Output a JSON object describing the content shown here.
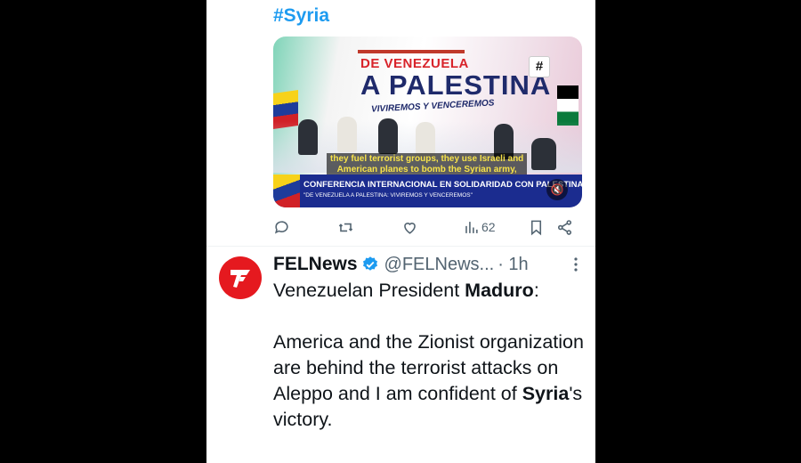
{
  "prev_tweet": {
    "hashtag": "#Syria",
    "media": {
      "title_small": "DE VENEZUELA",
      "title_big": "A PALESTINA",
      "title_sub": "VIVIREMOS Y VENCEREMOS",
      "tag": "#",
      "subtitle_line1": "they fuel terrorist groups, they use Israeli and",
      "subtitle_line2": "American planes to bomb the Syrian army,",
      "lower_third_main": "CONFERENCIA INTERNACIONAL EN SOLIDARIDAD CON PALESTINA",
      "lower_third_sub": "\"DE VENEZUELA A PALESTINA: VIVIREMOS Y VENCEREMOS\"",
      "mute_icon": "speaker-mute-icon"
    },
    "actions": {
      "reply_icon": "reply-icon",
      "retweet_icon": "retweet-icon",
      "like_icon": "heart-icon",
      "views_icon": "views-icon",
      "views_count": "62",
      "bookmark_icon": "bookmark-icon",
      "share_icon": "share-icon"
    }
  },
  "tweet": {
    "author_name": "FELNews",
    "handle": "@FELNews...",
    "time": "· 1h",
    "verified_color": "#1d9bf0",
    "avatar_color": "#e5191f",
    "line1_prefix": "Venezuelan President ",
    "line1_bold": "Maduro",
    "line1_suffix": ":",
    "line2": "America and the Zionist organization are behind the terrorist attacks on Aleppo and I am confident of ",
    "line2_bold": "Syria",
    "line2_suffix": "'s victory."
  },
  "colors": {
    "accent": "#1d9bf0",
    "text": "#0f1419",
    "muted": "#536471"
  }
}
